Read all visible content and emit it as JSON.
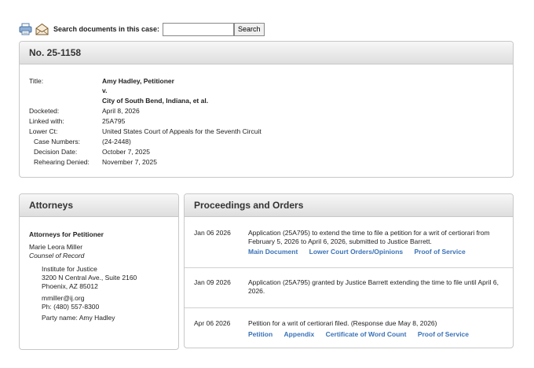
{
  "toolbar": {
    "print_icon": "printer-icon",
    "email_icon": "envelope-icon",
    "search_label": "Search documents in this case:",
    "search_value": "",
    "search_button": "Search"
  },
  "case": {
    "number": "No. 25-1158",
    "title_label": "Title:",
    "title_line1": "Amy Hadley, Petitioner",
    "title_line2": "v.",
    "title_line3": "City of South Bend, Indiana, et al.",
    "docketed_label": "Docketed:",
    "docketed": "April 8, 2026",
    "linked_label": "Linked with:",
    "linked": "25A795",
    "lower_ct_label": "Lower Ct:",
    "lower_ct": "United States Court of Appeals for the Seventh Circuit",
    "case_numbers_label": "Case Numbers:",
    "case_numbers": "(24-2448)",
    "decision_date_label": "Decision Date:",
    "decision_date": "October 7, 2025",
    "rehearing_label": "Rehearing Denied:",
    "rehearing": "November 7, 2025"
  },
  "attorneys": {
    "heading": "Attorneys",
    "group_label": "Attorneys for Petitioner",
    "name": "Marie Leora Miller",
    "role": "Counsel of Record",
    "org": "Institute for Justice",
    "address1": "3200 N Central Ave., Suite 2160",
    "address2": "Phoenix, AZ 85012",
    "email": "mmiller@ij.org",
    "phone": "Ph: (480) 557-8300",
    "party": "Party name: Amy Hadley"
  },
  "proceedings": {
    "heading": "Proceedings and Orders",
    "entries": [
      {
        "date": "Jan 06 2026",
        "text": "Application (25A795) to extend the time to file a petition for a writ of certiorari from February 5, 2026 to April 6, 2026, submitted to Justice Barrett.",
        "links": [
          "Main Document",
          "Lower Court Orders/Opinions",
          "Proof of Service"
        ]
      },
      {
        "date": "Jan 09 2026",
        "text": "Application (25A795) granted by Justice Barrett extending the time to file until April 6, 2026.",
        "links": []
      },
      {
        "date": "Apr 06 2026",
        "text": "Petition for a writ of certiorari filed. (Response due May 8, 2026)",
        "links": [
          "Petition",
          "Appendix",
          "Certificate of Word Count",
          "Proof of Service"
        ]
      }
    ]
  }
}
